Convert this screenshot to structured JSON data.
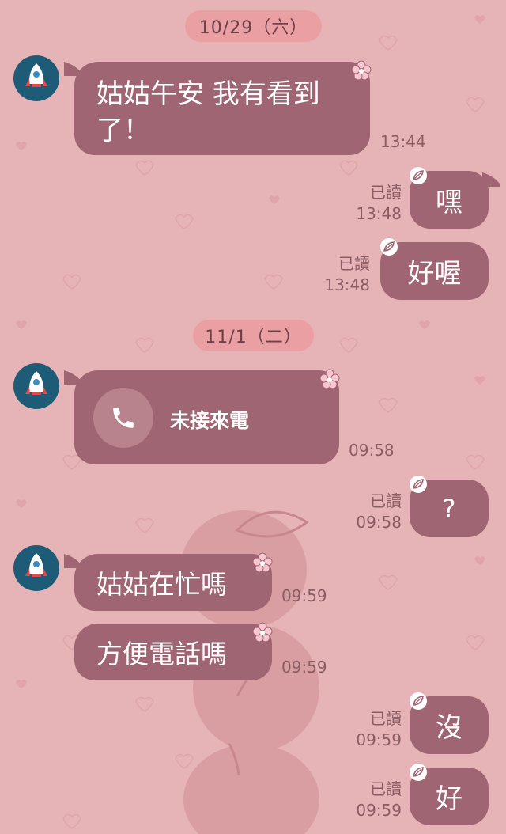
{
  "dates": {
    "first": "10/29（六）",
    "second": "11/1（二）"
  },
  "messages": {
    "m1": {
      "text_line1": "姑姑午安 我有看到",
      "text_line2": "了！",
      "time": "13:44"
    },
    "m2": {
      "text": "嘿",
      "read": "已讀",
      "time": "13:48"
    },
    "m3": {
      "text": "好喔",
      "read": "已讀",
      "time": "13:48"
    },
    "m4": {
      "text": "未接來電",
      "time": "09:58"
    },
    "m5": {
      "text": "?",
      "read": "已讀",
      "time": "09:58"
    },
    "m6": {
      "text": "姑姑在忙嗎",
      "time": "09:59"
    },
    "m7": {
      "text": "方便電話嗎",
      "time": "09:59"
    },
    "m8": {
      "text": "沒",
      "read": "已讀",
      "time": "09:59"
    },
    "m9": {
      "text": "好",
      "read": "已讀",
      "time": "09:59"
    }
  },
  "icons": {
    "avatar": "rocket-icon",
    "call": "phone-icon",
    "incoming_decoration": "flower-icon",
    "outgoing_decoration": "leaf-icon"
  },
  "colors": {
    "background": "#e6b4b6",
    "bubble": "#9f6572",
    "date_pill": "#eaa0a3",
    "avatar_bg": "#1e5b77"
  }
}
